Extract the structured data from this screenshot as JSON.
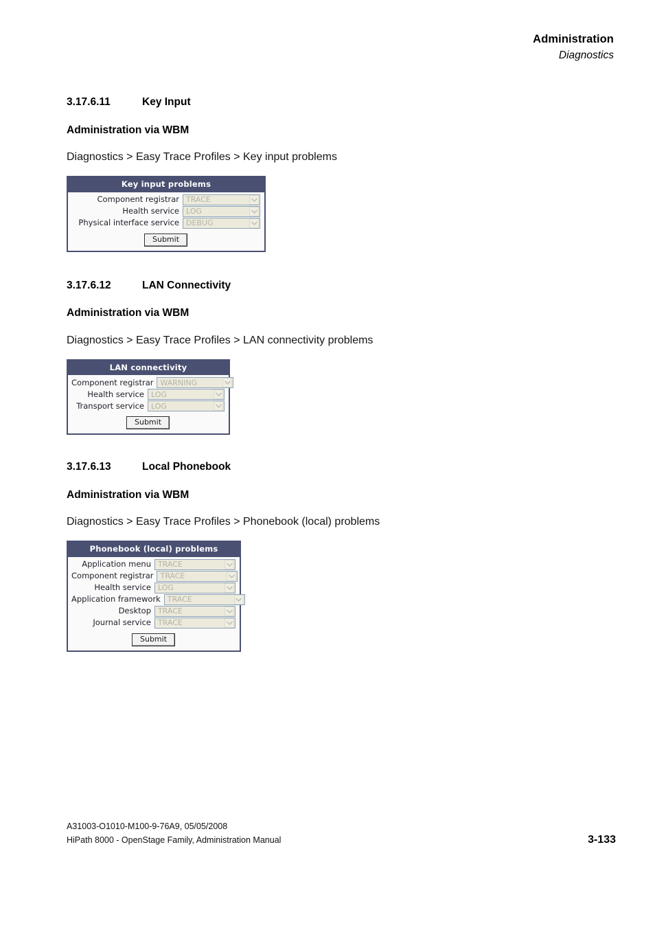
{
  "running_header": {
    "title": "Administration",
    "subtitle": "Diagnostics"
  },
  "sections": [
    {
      "number": "3.17.6.11",
      "title": "Key Input",
      "subheading": "Administration via WBM",
      "breadcrumb": "Diagnostics > Easy Trace Profiles > Key input problems",
      "widget": {
        "title": "Key input problems",
        "submit_label": "Submit",
        "rows": [
          {
            "label": "Component registrar",
            "value": "TRACE"
          },
          {
            "label": "Health service",
            "value": "LOG"
          },
          {
            "label": "Physical interface service",
            "value": "DEBUG"
          }
        ]
      }
    },
    {
      "number": "3.17.6.12",
      "title": "LAN Connectivity",
      "subheading": "Administration via WBM",
      "breadcrumb": "Diagnostics > Easy Trace Profiles > LAN connectivity problems",
      "widget": {
        "title": "LAN connectivity",
        "submit_label": "Submit",
        "rows": [
          {
            "label": "Component registrar",
            "value": "WARNING"
          },
          {
            "label": "Health service",
            "value": "LOG"
          },
          {
            "label": "Transport service",
            "value": "LOG"
          }
        ]
      }
    },
    {
      "number": "3.17.6.13",
      "title": "Local Phonebook",
      "subheading": "Administration via WBM",
      "breadcrumb": "Diagnostics > Easy Trace Profiles > Phonebook (local) problems",
      "widget": {
        "title": "Phonebook (local) problems",
        "submit_label": "Submit",
        "rows": [
          {
            "label": "Application menu",
            "value": "TRACE"
          },
          {
            "label": "Component registrar",
            "value": "TRACE"
          },
          {
            "label": "Health service",
            "value": "LOG"
          },
          {
            "label": "Application framework",
            "value": "TRACE"
          },
          {
            "label": "Desktop",
            "value": "TRACE"
          },
          {
            "label": "Journal service",
            "value": "TRACE"
          }
        ]
      }
    }
  ],
  "footer": {
    "doc_id": "A31003-O1010-M100-9-76A9, 05/05/2008",
    "doc_title": "HiPath 8000 - OpenStage Family, Administration Manual",
    "page_number": "3-133"
  },
  "colors": {
    "widget_header": "#4a5072",
    "widget_border": "#4a5072",
    "select_background": "#eceadb",
    "select_border": "#8fa3b8",
    "select_text": "#b3b3a8"
  }
}
